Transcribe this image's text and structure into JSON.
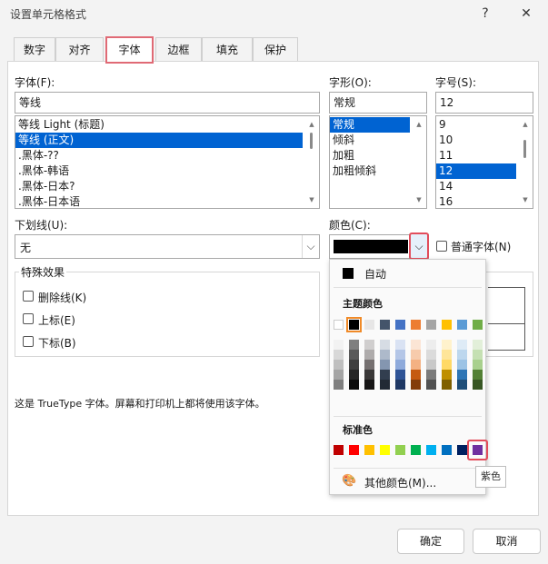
{
  "dialog": {
    "title": "设置单元格格式",
    "help": "?",
    "close": "✕"
  },
  "tabs": [
    {
      "label": "数字"
    },
    {
      "label": "对齐"
    },
    {
      "label": "字体"
    },
    {
      "label": "边框"
    },
    {
      "label": "填充"
    },
    {
      "label": "保护"
    }
  ],
  "font": {
    "label": "字体(F):",
    "value": "等线",
    "items": [
      "等线 Light (标题)",
      "等线 (正文)",
      ".黑体-??",
      ".黑体-韩语",
      ".黑体-日本?",
      ".黑体-日本语"
    ],
    "selected_index": 1
  },
  "style": {
    "label": "字形(O):",
    "value": "常规",
    "items": [
      "常规",
      "倾斜",
      "加粗",
      "加粗倾斜"
    ],
    "selected_index": 0
  },
  "size": {
    "label": "字号(S):",
    "value": "12",
    "items": [
      "9",
      "10",
      "11",
      "12",
      "14",
      "16"
    ],
    "selected_index": 3
  },
  "underline": {
    "label": "下划线(U):",
    "value": "无"
  },
  "color": {
    "label": "颜色(C):",
    "current": "#000000",
    "normal_font_label": "普通字体(N)"
  },
  "effects": {
    "title": "特殊效果",
    "strike": "删除线(K)",
    "superscript": "上标(E)",
    "subscript": "下标(B)"
  },
  "info_text": "这是 TrueType 字体。屏幕和打印机上都将使用该字体。",
  "buttons": {
    "ok": "确定",
    "cancel": "取消"
  },
  "color_popup": {
    "auto_label": "自动",
    "theme_label": "主题颜色",
    "standard_label": "标准色",
    "more_label": "其他颜色(M)...",
    "tooltip": "紫色",
    "theme_colors": [
      [
        "#ffffff",
        "#000000",
        "#e7e6e6",
        "#44546a",
        "#4472c4",
        "#ed7d31",
        "#a5a5a5",
        "#ffc000",
        "#5b9bd5",
        "#70ad47"
      ],
      [
        "#f2f2f2",
        "#7f7f7f",
        "#d0cece",
        "#d6dce4",
        "#d9e2f3",
        "#fbe5d5",
        "#ededed",
        "#fff2cc",
        "#deebf6",
        "#e2efd9"
      ],
      [
        "#d8d8d8",
        "#595959",
        "#aeabab",
        "#adb9ca",
        "#b4c6e7",
        "#f7cbac",
        "#dbdbdb",
        "#fee599",
        "#bdd7ee",
        "#c5e0b3"
      ],
      [
        "#bfbfbf",
        "#3f3f3f",
        "#757070",
        "#8496b0",
        "#8eaadb",
        "#f4b183",
        "#c9c9c9",
        "#ffd965",
        "#9cc3e5",
        "#a8d08d"
      ],
      [
        "#a5a5a5",
        "#262626",
        "#3a3838",
        "#323e4f",
        "#2f5496",
        "#c55a11",
        "#7b7b7b",
        "#bf8f00",
        "#2e75b5",
        "#538135"
      ],
      [
        "#7f7f7f",
        "#0c0c0c",
        "#171616",
        "#222a35",
        "#1f3864",
        "#833c0b",
        "#525252",
        "#7f6000",
        "#1e4e79",
        "#375623"
      ]
    ],
    "standard_colors": [
      "#c00000",
      "#ff0000",
      "#ffc000",
      "#ffff00",
      "#92d050",
      "#00b050",
      "#00b0f0",
      "#0070c0",
      "#002060",
      "#7030a0"
    ]
  }
}
